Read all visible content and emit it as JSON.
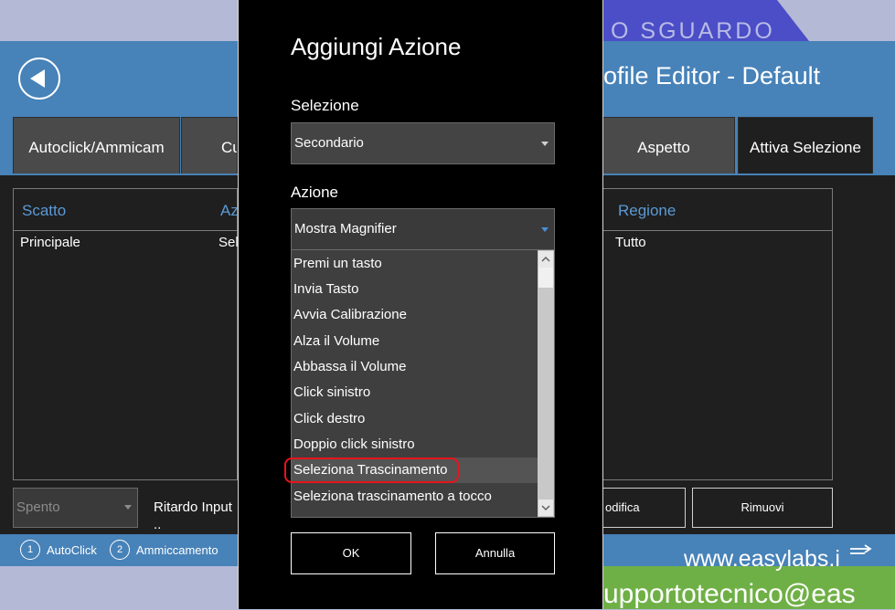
{
  "background": {
    "banner_text": "O SGUARDO",
    "website": "www.easylabs.i",
    "email": "upportotecnico@eas"
  },
  "header": {
    "title": "ofile Editor - Default"
  },
  "tabs": [
    {
      "label": "Autoclick/Ammicam"
    },
    {
      "label": "Cu"
    },
    {
      "label": "Aspetto"
    },
    {
      "label": "Attiva Selezione"
    }
  ],
  "table": {
    "headers": [
      "Scatto",
      "Az",
      "Regione"
    ],
    "rows": [
      {
        "scatto": "Principale",
        "azione": "Sel",
        "regione": "Tutto"
      }
    ]
  },
  "bottom_controls": {
    "mode_select": "Spento",
    "delay_label": "Ritardo Input",
    "delay_label_2": "..",
    "edit_button": "odifica",
    "remove_button": "Rimuovi"
  },
  "status_bar": {
    "item1_num": "1",
    "item1_label": "AutoClick",
    "item2_num": "2",
    "item2_label": "Ammiccamento",
    "right_icon": "hand-swipe-icon"
  },
  "dialog": {
    "title": "Aggiungi Azione",
    "selection_label": "Selezione",
    "selection_value": "Secondario",
    "action_label": "Azione",
    "action_value": "Mostra Magnifier",
    "options": [
      "Premi un tasto",
      "Invia Tasto",
      "Avvia Calibrazione",
      "Alza il Volume",
      "Abbassa il Volume",
      "Click sinistro",
      "Click destro",
      "Doppio click sinistro",
      "Seleziona Trascinamento",
      "Seleziona trascinamento a tocco"
    ],
    "highlighted_option": "Seleziona Trascinamento",
    "ok_label": "OK",
    "cancel_label": "Annulla"
  },
  "colors": {
    "header_blue": "#4782b8",
    "banner_blue": "#4b4ec6",
    "column_header_blue": "#5b9ad6",
    "highlight_red": "#e8141b",
    "green_footer": "#6fb046"
  }
}
